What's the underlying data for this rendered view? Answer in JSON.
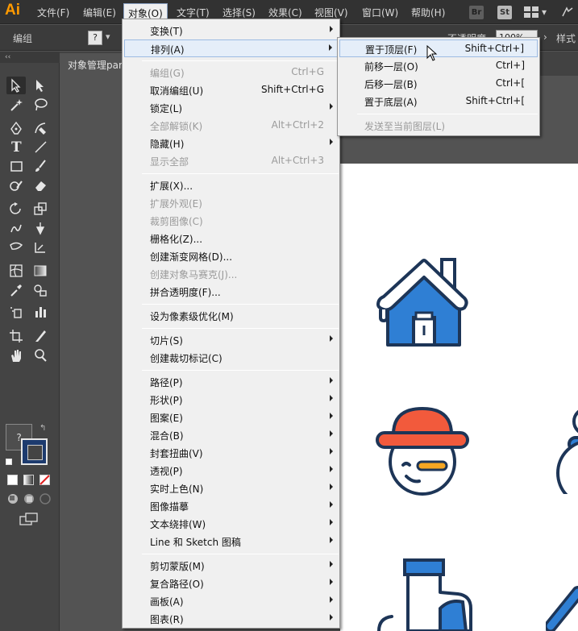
{
  "app": {
    "logo": "Ai",
    "menu": [
      {
        "label": "文件(F)"
      },
      {
        "label": "编辑(E)"
      },
      {
        "label": "对象(O)"
      },
      {
        "label": "文字(T)"
      },
      {
        "label": "选择(S)"
      },
      {
        "label": "效果(C)"
      },
      {
        "label": "视图(V)"
      },
      {
        "label": "窗口(W)"
      },
      {
        "label": "帮助(H)"
      }
    ],
    "app_buttons": {
      "br": "Br",
      "st": "St"
    }
  },
  "control_bar": {
    "label": "编组",
    "question": "?",
    "opacity_label": "不透明度",
    "opacity_value": "100%",
    "style_label": "样式"
  },
  "document": {
    "tab_title": "对象管理par"
  },
  "tools": {
    "fill_label": "?"
  },
  "object_menu": {
    "items": [
      {
        "label": "变换(T)",
        "shortcut": "",
        "submenu": true,
        "disabled": false
      },
      {
        "label": "排列(A)",
        "shortcut": "",
        "submenu": true,
        "disabled": false,
        "highlighted": true
      },
      {
        "label": "编组(G)",
        "shortcut": "Ctrl+G",
        "submenu": false,
        "disabled": true
      },
      {
        "label": "取消编组(U)",
        "shortcut": "Shift+Ctrl+G",
        "submenu": false,
        "disabled": false
      },
      {
        "label": "锁定(L)",
        "shortcut": "",
        "submenu": true,
        "disabled": false
      },
      {
        "label": "全部解锁(K)",
        "shortcut": "Alt+Ctrl+2",
        "submenu": false,
        "disabled": true
      },
      {
        "label": "隐藏(H)",
        "shortcut": "",
        "submenu": true,
        "disabled": false
      },
      {
        "label": "显示全部",
        "shortcut": "Alt+Ctrl+3",
        "submenu": false,
        "disabled": true
      },
      {
        "label": "扩展(X)...",
        "shortcut": "",
        "submenu": false,
        "disabled": false
      },
      {
        "label": "扩展外观(E)",
        "shortcut": "",
        "submenu": false,
        "disabled": true
      },
      {
        "label": "裁剪图像(C)",
        "shortcut": "",
        "submenu": false,
        "disabled": true
      },
      {
        "label": "栅格化(Z)...",
        "shortcut": "",
        "submenu": false,
        "disabled": false
      },
      {
        "label": "创建渐变网格(D)...",
        "shortcut": "",
        "submenu": false,
        "disabled": false
      },
      {
        "label": "创建对象马赛克(J)...",
        "shortcut": "",
        "submenu": false,
        "disabled": true
      },
      {
        "label": "拼合透明度(F)...",
        "shortcut": "",
        "submenu": false,
        "disabled": false
      },
      {
        "label": "设为像素级优化(M)",
        "shortcut": "",
        "submenu": false,
        "disabled": false
      },
      {
        "label": "切片(S)",
        "shortcut": "",
        "submenu": true,
        "disabled": false
      },
      {
        "label": "创建裁切标记(C)",
        "shortcut": "",
        "submenu": false,
        "disabled": false
      },
      {
        "label": "路径(P)",
        "shortcut": "",
        "submenu": true,
        "disabled": false
      },
      {
        "label": "形状(P)",
        "shortcut": "",
        "submenu": true,
        "disabled": false
      },
      {
        "label": "图案(E)",
        "shortcut": "",
        "submenu": true,
        "disabled": false
      },
      {
        "label": "混合(B)",
        "shortcut": "",
        "submenu": true,
        "disabled": false
      },
      {
        "label": "封套扭曲(V)",
        "shortcut": "",
        "submenu": true,
        "disabled": false
      },
      {
        "label": "透视(P)",
        "shortcut": "",
        "submenu": true,
        "disabled": false
      },
      {
        "label": "实时上色(N)",
        "shortcut": "",
        "submenu": true,
        "disabled": false
      },
      {
        "label": "图像描摹",
        "shortcut": "",
        "submenu": true,
        "disabled": false
      },
      {
        "label": "文本绕排(W)",
        "shortcut": "",
        "submenu": true,
        "disabled": false
      },
      {
        "label": "Line 和 Sketch 图稿",
        "shortcut": "",
        "submenu": true,
        "disabled": false
      },
      {
        "label": "剪切蒙版(M)",
        "shortcut": "",
        "submenu": true,
        "disabled": false
      },
      {
        "label": "复合路径(O)",
        "shortcut": "",
        "submenu": true,
        "disabled": false
      },
      {
        "label": "画板(A)",
        "shortcut": "",
        "submenu": true,
        "disabled": false
      },
      {
        "label": "图表(R)",
        "shortcut": "",
        "submenu": true,
        "disabled": false
      }
    ]
  },
  "arrange_submenu": {
    "items": [
      {
        "label": "置于顶层(F)",
        "shortcut": "Shift+Ctrl+]",
        "disabled": false,
        "highlighted": true
      },
      {
        "label": "前移一层(O)",
        "shortcut": "Ctrl+]",
        "disabled": false
      },
      {
        "label": "后移一层(B)",
        "shortcut": "Ctrl+[",
        "disabled": false
      },
      {
        "label": "置于底层(A)",
        "shortcut": "Shift+Ctrl+[",
        "disabled": false
      },
      {
        "label": "发送至当前图层(L)",
        "shortcut": "",
        "disabled": true
      }
    ]
  },
  "colors": {
    "icon_blue": "#2f7fd4",
    "icon_navy": "#1d3557",
    "icon_orange": "#f25a3c",
    "highlight": "#e5eef9"
  }
}
